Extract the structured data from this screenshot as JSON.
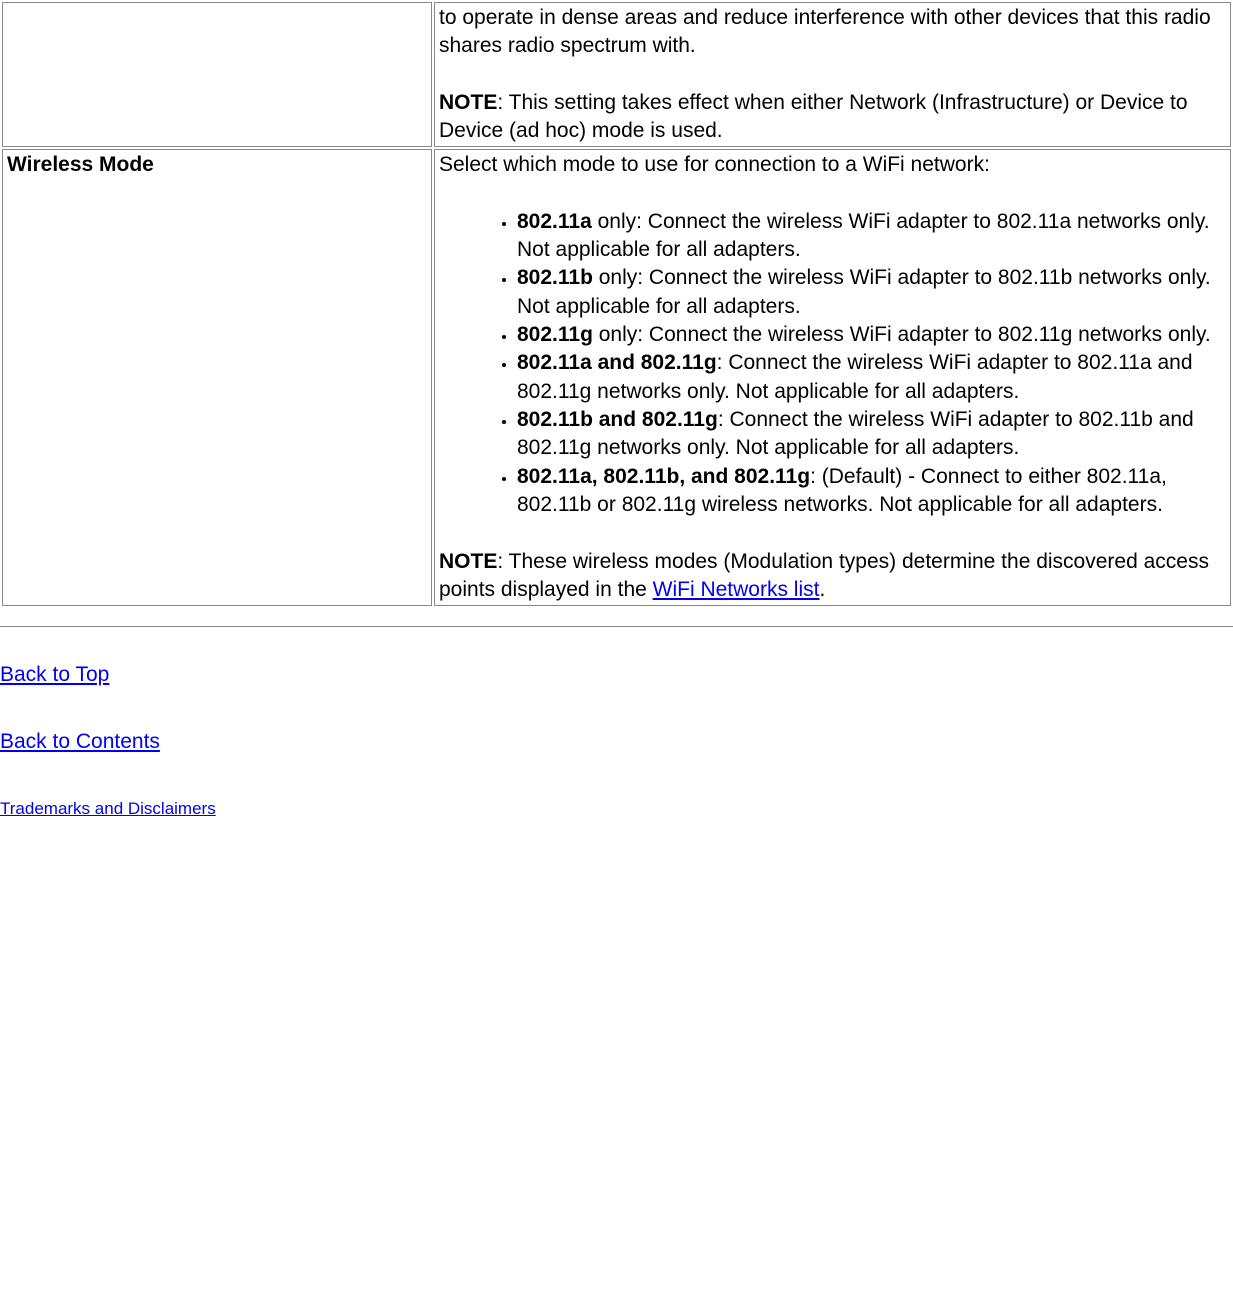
{
  "row1": {
    "desc_frag": "to operate in dense areas and reduce interference with other devices that this radio shares radio spectrum with.",
    "note_label": "NOTE",
    "note_text": ": This setting takes effect when either Network (Infrastructure) or Device to Device (ad hoc) mode is used."
  },
  "row2": {
    "label": "Wireless Mode",
    "intro": "Select which mode to use for connection to a WiFi network:",
    "modes": [
      {
        "name": "802.11a",
        "text": " only: Connect the wireless WiFi adapter to 802.11a networks only. Not applicable for all adapters."
      },
      {
        "name": "802.11b",
        "text": " only: Connect the wireless WiFi adapter to 802.11b networks only. Not applicable for all adapters."
      },
      {
        "name": "802.11g",
        "text": " only: Connect the wireless WiFi adapter to 802.11g networks only."
      },
      {
        "name": "802.11a and 802.11g",
        "text": ": Connect the wireless WiFi adapter to 802.11a and 802.11g networks only. Not applicable for all adapters."
      },
      {
        "name": "802.11b and 802.11g",
        "text": ": Connect the wireless WiFi adapter to 802.11b and 802.11g networks only. Not applicable for all adapters."
      },
      {
        "name": "802.11a, 802.11b, and 802.11g",
        "text": ": (Default) - Connect to either 802.11a, 802.11b or 802.11g wireless networks. Not applicable for all adapters."
      }
    ],
    "note_label": "NOTE",
    "note_pre": ": These wireless modes (Modulation types) determine the discovered access points displayed in the ",
    "note_link": "WiFi Networks list",
    "note_post": "."
  },
  "footer": {
    "back_to_top": "Back to Top",
    "back_to_contents": "Back to Contents",
    "trademarks": "Trademarks and Disclaimers"
  }
}
